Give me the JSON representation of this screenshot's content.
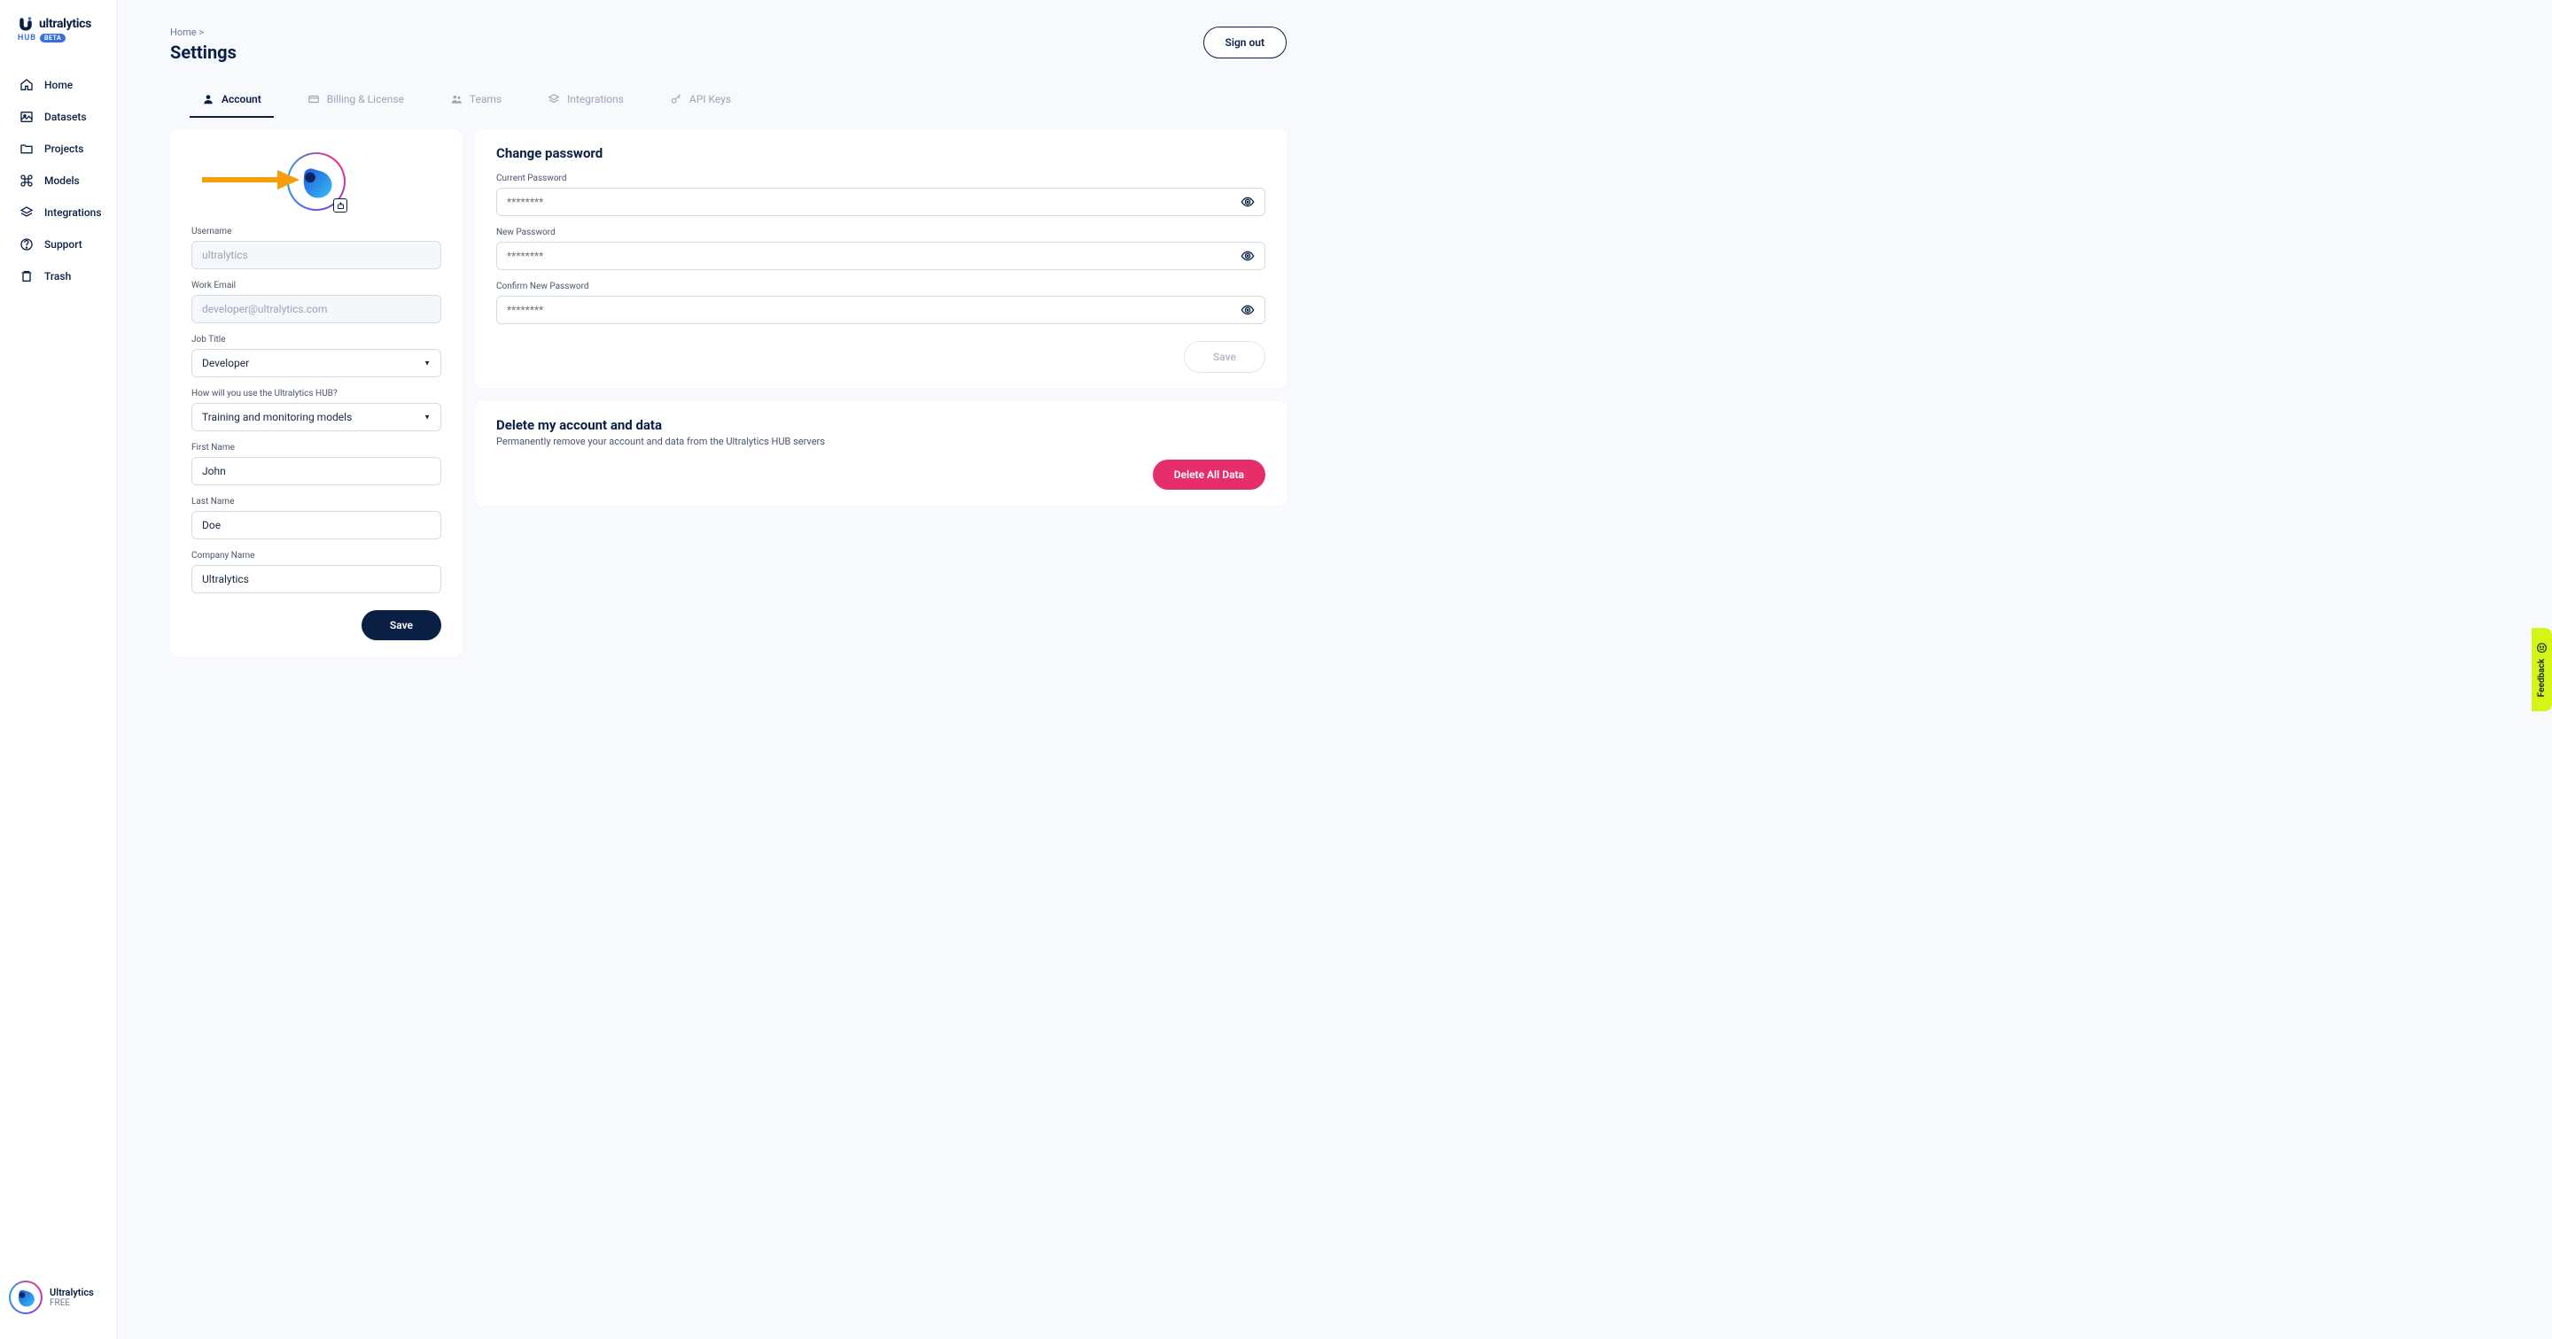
{
  "brand": {
    "name": "ultralytics",
    "hub": "HUB",
    "beta": "BETA"
  },
  "sidebar": {
    "items": [
      {
        "label": "Home"
      },
      {
        "label": "Datasets"
      },
      {
        "label": "Projects"
      },
      {
        "label": "Models"
      },
      {
        "label": "Integrations"
      },
      {
        "label": "Support"
      },
      {
        "label": "Trash"
      }
    ]
  },
  "user": {
    "name": "Ultralytics",
    "plan": "FREE"
  },
  "breadcrumb": {
    "home": "Home",
    "sep": ">"
  },
  "page": {
    "title": "Settings"
  },
  "signout": "Sign out",
  "tabs": [
    {
      "label": "Account"
    },
    {
      "label": "Billing & License"
    },
    {
      "label": "Teams"
    },
    {
      "label": "Integrations"
    },
    {
      "label": "API Keys"
    }
  ],
  "profile": {
    "username_label": "Username",
    "username_value": "ultralytics",
    "email_label": "Work Email",
    "email_value": "developer@ultralytics.com",
    "jobtitle_label": "Job Title",
    "jobtitle_value": "Developer",
    "usage_label": "How will you use the Ultralytics HUB?",
    "usage_value": "Training and monitoring models",
    "firstname_label": "First Name",
    "firstname_value": "John",
    "lastname_label": "Last Name",
    "lastname_value": "Doe",
    "company_label": "Company Name",
    "company_value": "Ultralytics",
    "save": "Save"
  },
  "password": {
    "title": "Change password",
    "current_label": "Current Password",
    "new_label": "New Password",
    "confirm_label": "Confirm New Password",
    "placeholder": "********",
    "save": "Save"
  },
  "delete": {
    "title": "Delete my account and data",
    "desc": "Permanently remove your account and data from the Ultralytics HUB servers",
    "button": "Delete All Data"
  },
  "feedback": "Feedback"
}
